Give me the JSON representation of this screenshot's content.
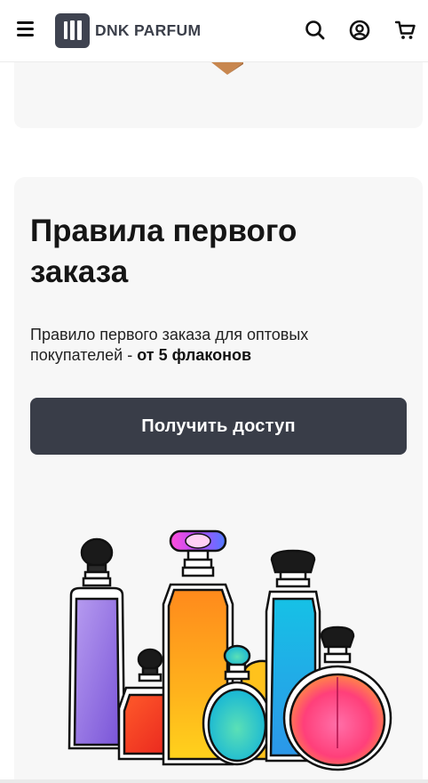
{
  "header": {
    "menu_icon": "hamburger-menu-icon",
    "logo_text": "DNK PARFUM",
    "search_icon": "search-icon",
    "account_icon": "account-icon",
    "cart_icon": "cart-icon"
  },
  "first_order": {
    "title": "Правила первого заказа",
    "description_text": "Правило первого заказа для оптовых покупателей - ",
    "description_bold": "от 5 флаконов",
    "cta_label": "Получить доступ",
    "illustration": "perfume-bottles-illustration"
  },
  "colors": {
    "accent": "#393d48",
    "card_background": "#f7f7f7",
    "logo": "#3f4350"
  }
}
